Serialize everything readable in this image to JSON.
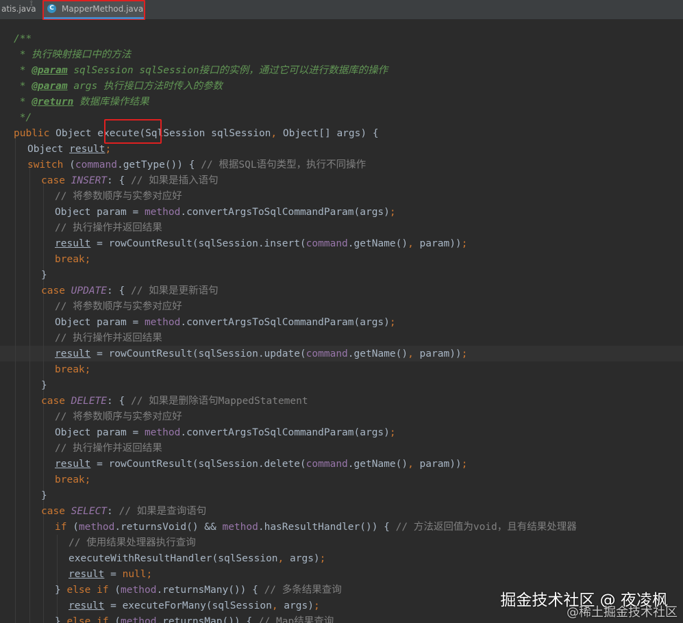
{
  "tabs": {
    "inactive_label": "atis.java",
    "pin_glyph": "⟟",
    "active_icon_letter": "C",
    "active_label": "MapperMethod.java",
    "active_icon_color": "#3592c4"
  },
  "colors": {
    "background": "#2b2b2b",
    "keyword": "#cc7832",
    "field": "#9876aa",
    "doc_comment": "#629755",
    "line_comment": "#808080",
    "plain": "#a9b7c6",
    "highlight_box": "#e02020"
  },
  "code": {
    "l1": "/**",
    "l2": " * 执行映射接口中的方法",
    "l3_a": " * ",
    "l3_tag": "@param",
    "l3_b": " sqlSession sqlSession接口的实例，通过它可以进行数据库的操作",
    "l4_a": " * ",
    "l4_tag": "@param",
    "l4_b": " args 执行接口方法时传入的参数",
    "l5_a": " * ",
    "l5_tag": "@return",
    "l5_b": " 数据库操作结果",
    "l6": " */",
    "l7_kw": "public",
    "l7_a": " Object ",
    "l7_method": "execute",
    "l7_b": "(SqlSession sqlSession",
    "l7_comma": ",",
    "l7_c": " Object[] args) {",
    "l8_a": "Object ",
    "l8_var": "result",
    "l8_semi": ";",
    "l9_kw": "switch",
    "l9_a": " (",
    "l9_field": "command",
    "l9_b": ".getType()) { ",
    "l9_comment": "// 根据SQL语句类型，执行不同操作",
    "l10_kw": "case",
    "l10_const": "INSERT",
    "l10_a": ": { ",
    "l10_comment": "// 如果是插入语句",
    "l11": "// 将参数顺序与实参对应好",
    "l12_a": "Object param = ",
    "l12_field": "method",
    "l12_b": ".convertArgsToSqlCommandParam(args)",
    "l12_semi": ";",
    "l13": "// 执行操作并返回结果",
    "l14_var": "result",
    "l14_a": " = rowCountResult(sqlSession.insert(",
    "l14_field": "command",
    "l14_b": ".getName()",
    "l14_comma": ",",
    "l14_c": " param))",
    "l14_semi": ";",
    "l15": "break;",
    "l16": "}",
    "l17_kw": "case",
    "l17_const": "UPDATE",
    "l17_a": ": { ",
    "l17_comment": "// 如果是更新语句",
    "l18": "// 将参数顺序与实参对应好",
    "l19_a": "Object param = ",
    "l19_field": "method",
    "l19_b": ".convertArgsToSqlCommandParam(args)",
    "l19_semi": ";",
    "l20": "// 执行操作并返回结果",
    "l21_var": "result",
    "l21_a": " = rowCountResult(sqlSession.update(",
    "l21_field": "command",
    "l21_b": ".getName()",
    "l21_comma": ",",
    "l21_c": " param))",
    "l21_semi": ";",
    "l22": "break;",
    "l23": "}",
    "l24_kw": "case",
    "l24_const": "DELETE",
    "l24_a": ": { ",
    "l24_comment": "// 如果是删除语句MappedStatement",
    "l25": "// 将参数顺序与实参对应好",
    "l26_a": "Object param = ",
    "l26_field": "method",
    "l26_b": ".convertArgsToSqlCommandParam(args)",
    "l26_semi": ";",
    "l27": "// 执行操作并返回结果",
    "l28_var": "result",
    "l28_a": " = rowCountResult(sqlSession.delete(",
    "l28_field": "command",
    "l28_b": ".getName()",
    "l28_comma": ",",
    "l28_c": " param))",
    "l28_semi": ";",
    "l29": "break;",
    "l30": "}",
    "l31_kw": "case",
    "l31_const": "SELECT",
    "l31_a": ": ",
    "l31_comment": "// 如果是查询语句",
    "l32_kw": "if",
    "l32_a": " (",
    "l32_field": "method",
    "l32_b": ".returnsVoid() && ",
    "l32_field2": "method",
    "l32_c": ".hasResultHandler()) { ",
    "l32_comment": "// 方法返回值为void，且有结果处理器",
    "l33": "// 使用结果处理器执行查询",
    "l34_a": "executeWithResultHandler(sqlSession",
    "l34_comma": ",",
    "l34_b": " args)",
    "l34_semi": ";",
    "l35_var": "result",
    "l35_a": " = ",
    "l35_kw": "null;",
    "l36_a": "} ",
    "l36_kw": "else if",
    "l36_b": " (",
    "l36_field": "method",
    "l36_c": ".returnsMany()) { ",
    "l36_comment": "// 多条结果查询",
    "l37_var": "result",
    "l37_a": " = executeForMany(sqlSession",
    "l37_comma": ",",
    "l37_b": " args)",
    "l37_semi": ";",
    "l38_a": "} ",
    "l38_kw": "else if",
    "l38_b": " (",
    "l38_field": "method",
    "l38_c": ".returnsMap()) { ",
    "l38_comment": "// Map结果查询"
  },
  "watermark": {
    "main": "掘金技术社区 @ 夜凌枫",
    "sub": "@稀土掘金技术社区"
  }
}
